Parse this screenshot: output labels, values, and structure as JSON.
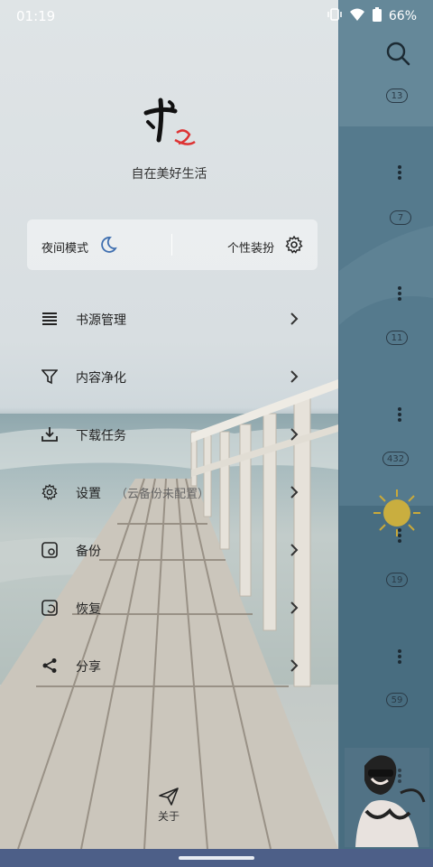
{
  "status_bar": {
    "time": "01:19",
    "battery": "66%"
  },
  "drawer": {
    "slogan": "自在美好生活",
    "night_mode_label": "夜间模式",
    "theme_label": "个性装扮",
    "menu": [
      {
        "label": "书源管理",
        "icon": "list-icon"
      },
      {
        "label": "内容净化",
        "icon": "filter-icon"
      },
      {
        "label": "下载任务",
        "icon": "download-icon"
      },
      {
        "label": "设置",
        "sub": "（云备份未配置）",
        "icon": "gear-icon"
      },
      {
        "label": "备份",
        "icon": "backup-icon"
      },
      {
        "label": "恢复",
        "icon": "restore-icon"
      },
      {
        "label": "分享",
        "icon": "share-icon"
      }
    ],
    "about_label": "关于"
  },
  "list_badges": [
    "13",
    "7",
    "11",
    "432",
    "19",
    "59"
  ]
}
